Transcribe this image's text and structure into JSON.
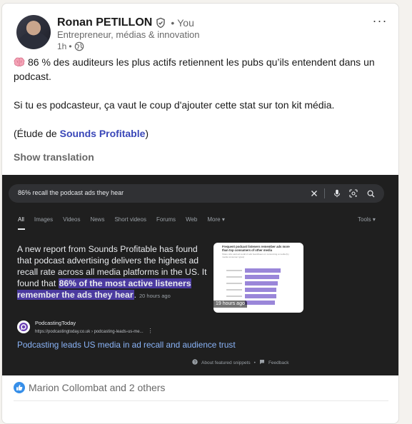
{
  "post": {
    "author_name": "Ronan PETILLON",
    "separator": "•",
    "you_label": "You",
    "headline": "Entrepreneur, médias & innovation",
    "time": "1h",
    "time_separator": "•",
    "menu_label": "···",
    "text_line1": "86 % des auditeurs les plus actifs retiennent les pubs qu’ils entendent dans un podcast.",
    "text_line2": "Si tu es podcasteur, ça vaut le coup d'ajouter cette stat sur ton kit média.",
    "text_line3_prefix": "(Étude de ",
    "text_line3_link": "Sounds Profitable",
    "text_line3_suffix": ")",
    "show_translation": "Show translation",
    "reactions_text": "Marion Collombat and 2 others"
  },
  "screenshot": {
    "search_query": "86% recall the podcast ads they hear",
    "tabs": [
      "All",
      "Images",
      "Videos",
      "News",
      "Short videos",
      "Forums",
      "Web",
      "More ▾"
    ],
    "tools": "Tools ▾",
    "snippet_plain": "A new report from Sounds Profitable has found that podcast advertising delivers the highest ad recall rate across all media platforms in the US. It found that ",
    "snippet_highlight": "86% of the most active listeners remember the ads they hear",
    "snippet_end": ".",
    "snippet_age": "20 hours ago",
    "thumb_title": "Frequent podcast listeners remember ads more than top consumers of other media",
    "thumb_sub": "Share who said ad recall of ads heard/seen on consuming a media (by media consumer types)",
    "thumb_age": "19 hours ago",
    "source_name": "PodcastingToday",
    "source_url": "https://podcastingtoday.co.uk › podcasting-leads-us-me...",
    "source_menu": "⋮",
    "result_title": "Podcasting leads US media in ad recall and audience trust",
    "about_label": "About featured snippets",
    "footer_sep": "•",
    "feedback_label": "Feedback"
  }
}
